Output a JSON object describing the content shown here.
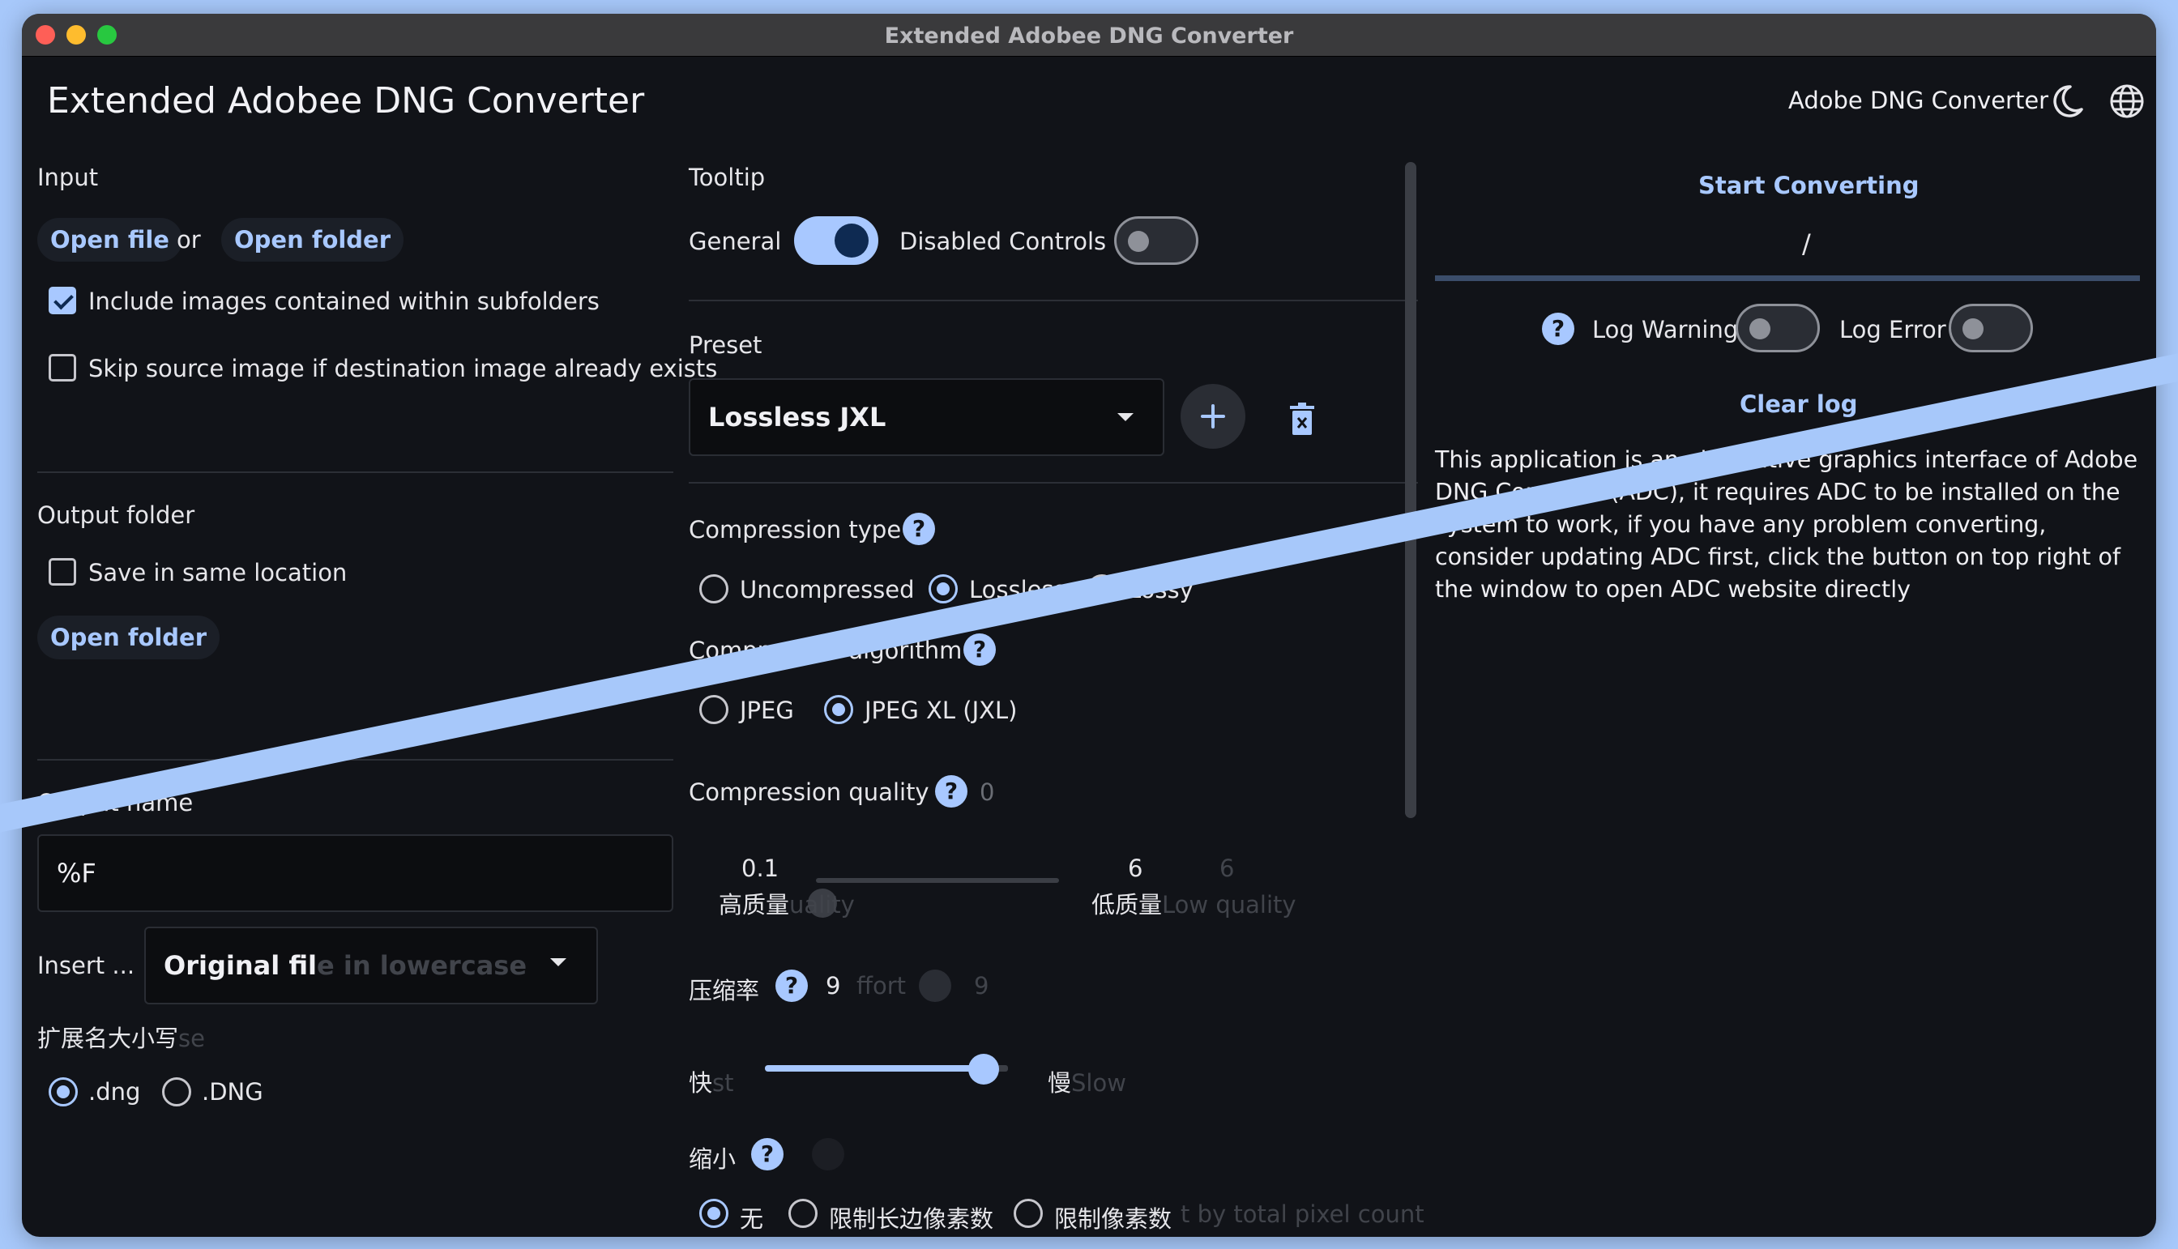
{
  "window": {
    "title": "Extended Adobee DNG Converter"
  },
  "header": {
    "app_title": "Extended Adobee DNG Converter",
    "adc_link": "Adobe DNG Converter",
    "theme_icon": "moon-icon",
    "language_icon": "globe-icon"
  },
  "input": {
    "heading": "Input",
    "open_file": "Open file",
    "or": "or",
    "open_folder": "Open folder",
    "include_subfolders": {
      "label": "Include images contained within subfolders",
      "checked": true
    },
    "skip_existing": {
      "label": "Skip source image if destination image already exists",
      "checked": false
    }
  },
  "output_folder": {
    "heading": "Output folder",
    "same_location": {
      "label": "Save in same location",
      "checked": false
    },
    "open_folder": "Open folder"
  },
  "output_name": {
    "heading": "Output name",
    "value": "%F",
    "insert_label": "Insert ...",
    "insert_value": "Original fil",
    "insert_ghost": "e in lowercase"
  },
  "extension": {
    "heading": "扩展名大小写",
    "heading_ghost": "se",
    "options": [
      ".dng",
      ".DNG"
    ],
    "selected": ".dng"
  },
  "tooltip": {
    "heading": "Tooltip",
    "general": {
      "label": "General",
      "on": true
    },
    "disabled_controls": {
      "label": "Disabled Controls",
      "on": false
    }
  },
  "preset": {
    "heading": "Preset",
    "value": "Lossless JXL",
    "add_icon": "plus-icon",
    "delete_icon": "trash-icon"
  },
  "compression_type": {
    "heading": "Compression type",
    "options": [
      "Uncompressed",
      "Lossless",
      "Lossy"
    ],
    "selected": "Lossless"
  },
  "compression_algorithm": {
    "heading": "Compression algorithm",
    "options": [
      "JPEG",
      "JPEG XL (JXL)"
    ],
    "selected": "JPEG XL (JXL)"
  },
  "compression_quality": {
    "heading": "Compression quality",
    "value": "0",
    "min_value": "0.1",
    "min_label": "高质量",
    "min_ghost": "uality",
    "max_value": "6",
    "max_label": "低质量",
    "max_value_ghost": "6",
    "max_ghost": "Low quality"
  },
  "effort": {
    "heading": "压缩率",
    "value": "9",
    "ghost_heading": "ffort",
    "ghost_value": "9",
    "fast": "快",
    "fast_ghost": "st",
    "slow": "慢",
    "slow_ghost": "Slow",
    "level": 0.9
  },
  "downscale": {
    "heading": "缩小",
    "options": [
      "无",
      "限制长边像素数",
      "限制像素数"
    ],
    "selected": "无",
    "ghost": "t by total pixel count"
  },
  "log": {
    "start": "Start Converting",
    "progress": "/",
    "warning": {
      "label": "Log Warning",
      "on": false
    },
    "error": {
      "label": "Log Error",
      "on": false
    },
    "clear": "Clear log",
    "message": "This application is an alternative graphics interface of Adobe DNG Converter(ADC), it requires ADC to be installed on the system to work, if you have any problem converting, consider updating ADC first, click the button on top right of the window to open ADC website directly"
  },
  "colors": {
    "accent": "#a8c8ff",
    "background": "#111318",
    "border": "#a7c8fa"
  }
}
